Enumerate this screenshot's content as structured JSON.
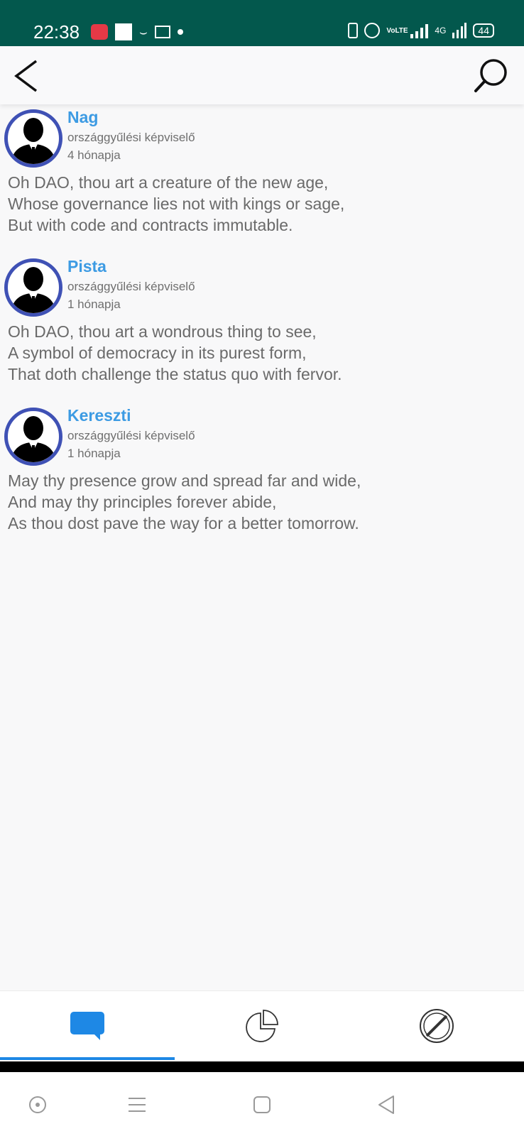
{
  "status_bar": {
    "time": "22:38",
    "battery": "44",
    "network": "4G",
    "volte": "VoLTE"
  },
  "app_bar": {
    "back_icon": "arrow-back-icon",
    "search_icon": "search-icon"
  },
  "posts": [
    {
      "author": "Nag",
      "role": "országgyűlési képviselő",
      "time": "4 hónapja",
      "lines": [
        "Oh DAO, thou art a creature of the new age,",
        "Whose governance lies not with kings or sage,",
        "But with code and contracts immutable."
      ]
    },
    {
      "author": "Pista",
      "role": "országgyűlési képviselő",
      "time": "1 hónapja",
      "lines": [
        "Oh DAO, thou art a wondrous thing to see,",
        "A symbol of democracy in its purest form,",
        "That doth challenge the status quo with fervor."
      ]
    },
    {
      "author": "Kereszti",
      "role": "országgyűlési képviselő",
      "time": "1 hónapja",
      "lines": [
        "May thy presence grow and spread far and wide,",
        "And may thy principles forever abide,",
        "As thou dost pave the way for a better tomorrow."
      ]
    }
  ],
  "bottom_nav": {
    "tabs": [
      {
        "icon": "chat-icon",
        "active": true
      },
      {
        "icon": "pie-chart-icon",
        "active": false
      },
      {
        "icon": "blocked-icon",
        "active": false
      }
    ]
  },
  "colors": {
    "status_bar": "#03584d",
    "author_name": "#3d9be3",
    "avatar_ring": "#3f51b5",
    "active_tab": "#1e88e5"
  }
}
